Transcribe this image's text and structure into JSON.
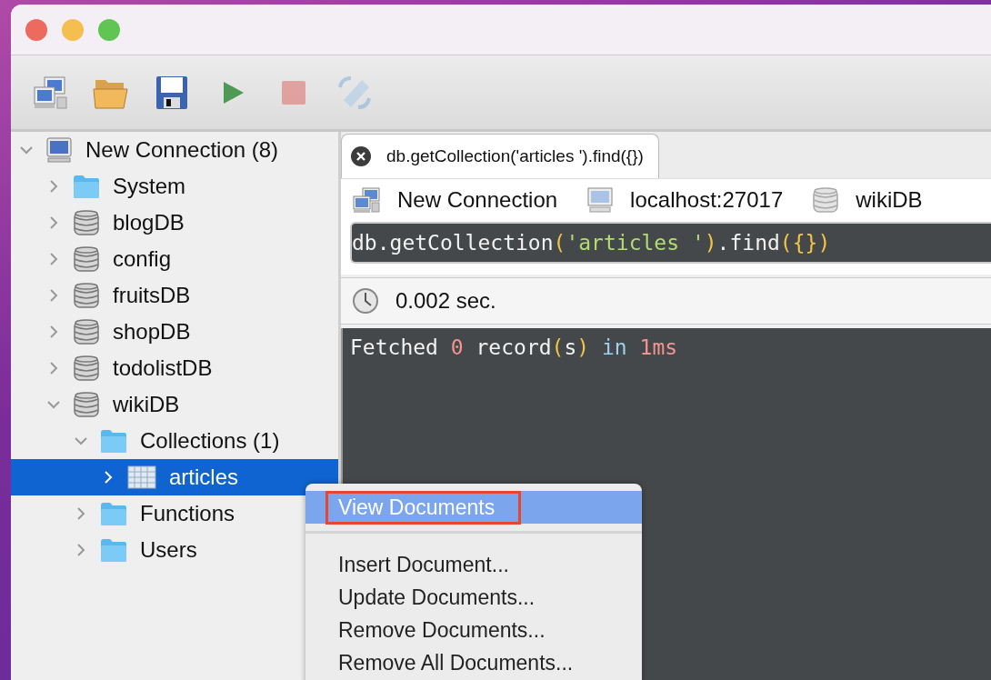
{
  "toolbar": [
    {
      "kind": "connect",
      "disabled": false
    },
    {
      "kind": "open",
      "disabled": false
    },
    {
      "kind": "save",
      "disabled": false
    },
    {
      "kind": "run",
      "disabled": false
    },
    {
      "kind": "stop",
      "disabled": true
    },
    {
      "kind": "format",
      "disabled": true
    }
  ],
  "tree": {
    "items": [
      {
        "label": "New Connection (8)",
        "kind": "computer",
        "expanded": true,
        "selected": false,
        "children": [
          {
            "label": "System",
            "kind": "folder",
            "expanded": false,
            "selected": false
          },
          {
            "label": "blogDB",
            "kind": "database",
            "expanded": false,
            "selected": false
          },
          {
            "label": "config",
            "kind": "database",
            "expanded": false,
            "selected": false
          },
          {
            "label": "fruitsDB",
            "kind": "database",
            "expanded": false,
            "selected": false
          },
          {
            "label": "shopDB",
            "kind": "database",
            "expanded": false,
            "selected": false
          },
          {
            "label": "todolistDB",
            "kind": "database",
            "expanded": false,
            "selected": false
          },
          {
            "label": "wikiDB",
            "kind": "database",
            "expanded": true,
            "selected": false,
            "children": [
              {
                "label": "Collections (1)",
                "kind": "folder",
                "expanded": true,
                "selected": false,
                "children": [
                  {
                    "label": "articles",
                    "kind": "table",
                    "expanded": false,
                    "selected": true
                  }
                ]
              },
              {
                "label": "Functions",
                "kind": "folder",
                "expanded": false,
                "selected": false
              },
              {
                "label": "Users",
                "kind": "folder",
                "expanded": false,
                "selected": false
              }
            ]
          }
        ]
      }
    ]
  },
  "tabs": [
    {
      "title": "db.getCollection('articles ').find({})",
      "selected": true
    }
  ],
  "connection_bar": [
    {
      "kind": "connection",
      "text": "New Connection"
    },
    {
      "kind": "server",
      "text": "localhost:27017"
    },
    {
      "kind": "database",
      "text": "wikiDB"
    }
  ],
  "query": [
    {
      "kind": "plain",
      "text": "db.getCollection"
    },
    {
      "kind": "punct",
      "text": "("
    },
    {
      "kind": "string",
      "text": "'articles '"
    },
    {
      "kind": "punct",
      "text": ")"
    },
    {
      "kind": "plain",
      "text": ".find"
    },
    {
      "kind": "punct",
      "text": "({})"
    }
  ],
  "elapsed": "0.002 sec.",
  "output": [
    {
      "kind": "plain",
      "text": "Fetched "
    },
    {
      "kind": "number",
      "text": "0"
    },
    {
      "kind": "plain",
      "text": " record"
    },
    {
      "kind": "punct",
      "text": "("
    },
    {
      "kind": "plain",
      "text": "s"
    },
    {
      "kind": "punct",
      "text": ")"
    },
    {
      "kind": "keyword",
      "text": " in "
    },
    {
      "kind": "number",
      "text": "1ms"
    }
  ],
  "context_menu": [
    {
      "kind": "item",
      "label": "View Documents",
      "selected": true,
      "outlined": true
    },
    {
      "kind": "separator"
    },
    {
      "kind": "item",
      "label": "Insert Document...",
      "selected": false,
      "outlined": false
    },
    {
      "kind": "item",
      "label": "Update Documents...",
      "selected": false,
      "outlined": false
    },
    {
      "kind": "item",
      "label": "Remove Documents...",
      "selected": false,
      "outlined": false
    },
    {
      "kind": "item",
      "label": "Remove All Documents...",
      "selected": false,
      "outlined": false
    }
  ]
}
